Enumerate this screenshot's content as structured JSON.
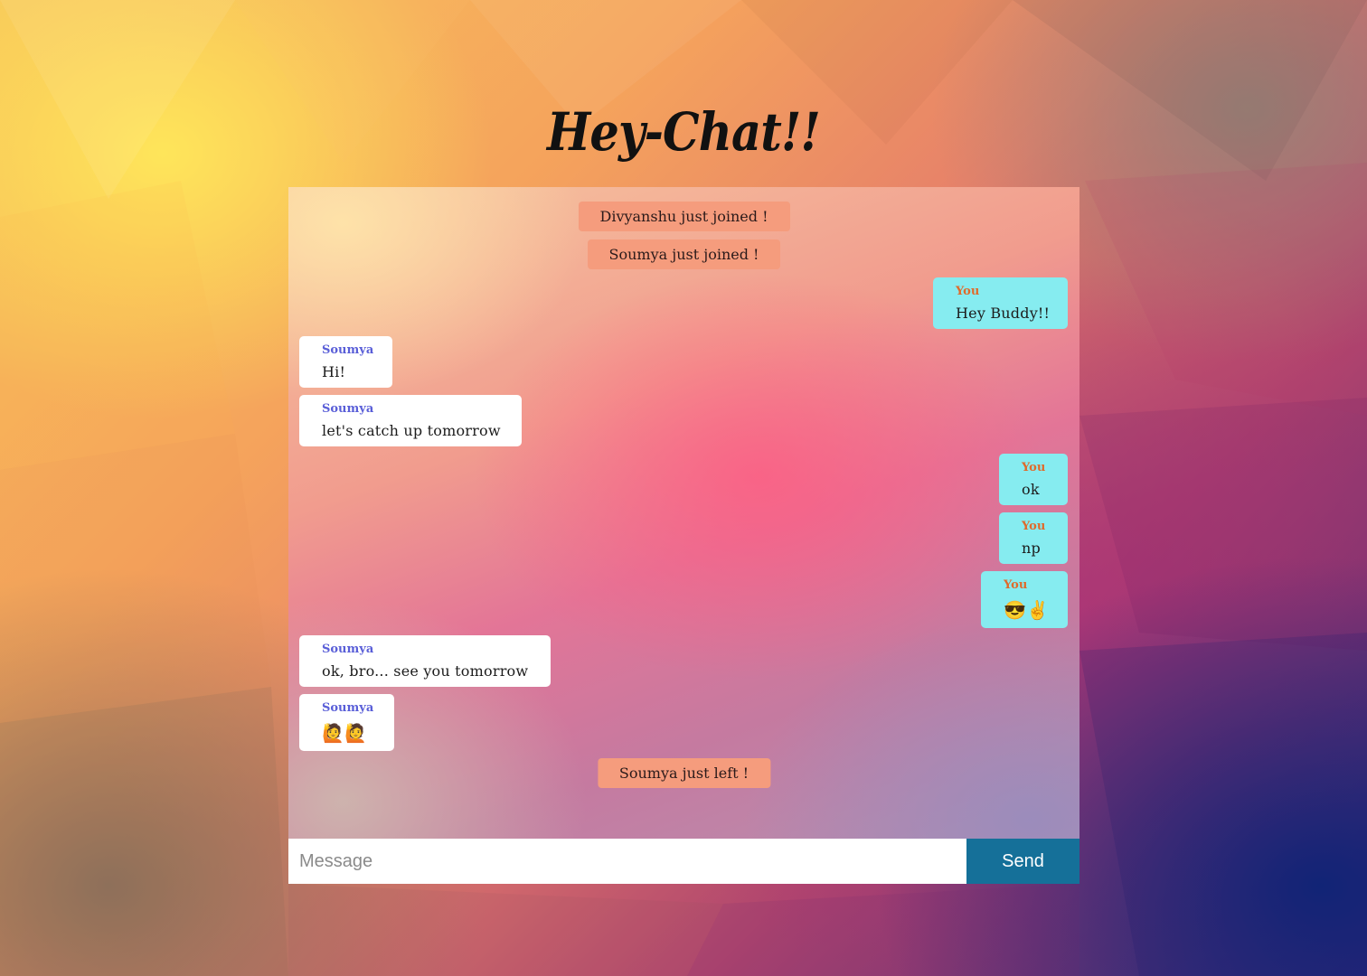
{
  "app": {
    "title": "Hey-Chat!!"
  },
  "messages": [
    {
      "kind": "notice",
      "text": "Divyanshu just joined !"
    },
    {
      "kind": "notice",
      "text": "Soumya just joined !"
    },
    {
      "kind": "outgoing",
      "sender": "You",
      "text": "Hey Buddy!!"
    },
    {
      "kind": "incoming",
      "sender": "Soumya",
      "text": "Hi!"
    },
    {
      "kind": "incoming",
      "sender": "Soumya",
      "text": "let's catch up tomorrow"
    },
    {
      "kind": "outgoing",
      "sender": "You",
      "text": "ok"
    },
    {
      "kind": "outgoing",
      "sender": "You",
      "text": "np"
    },
    {
      "kind": "outgoing",
      "sender": "You",
      "text": "😎✌",
      "emoji": [
        "smiling-face-with-sunglasses-icon",
        "victory-hand-icon"
      ]
    },
    {
      "kind": "incoming",
      "sender": "Soumya",
      "text": "ok, bro... see you tomorrow"
    },
    {
      "kind": "incoming",
      "sender": "Soumya",
      "text": "🙋🙋",
      "emoji": [
        "person-raising-hand-icon",
        "person-raising-hand-icon"
      ]
    },
    {
      "kind": "notice",
      "text": "Soumya just left !"
    }
  ],
  "composer": {
    "placeholder": "Message",
    "value": "",
    "send_label": "Send"
  },
  "colors": {
    "notice_bg": "#f59c7d",
    "incoming_bg": "#ffffff",
    "outgoing_bg": "#86ecf0",
    "incoming_sender": "#5a5fd8",
    "outgoing_sender": "#e06a2a",
    "send_button": "#157099"
  }
}
